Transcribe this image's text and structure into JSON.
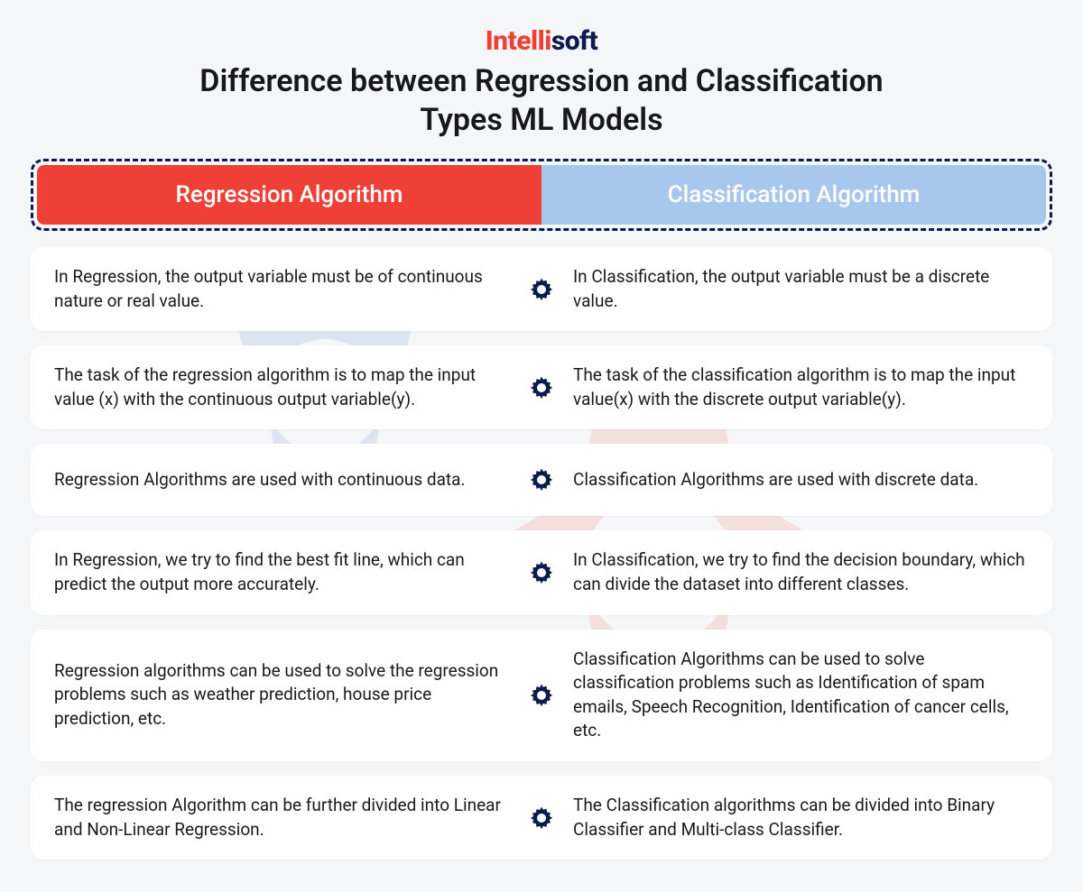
{
  "logo": {
    "part1": "Intelli",
    "part2": "soft"
  },
  "title_line1": "Difference between Regression and Classification",
  "title_line2": "Types ML Models",
  "header": {
    "left": "Regression Algorithm",
    "right": "Classification Algorithm"
  },
  "rows": [
    {
      "left": "In Regression, the output variable must be of continuous nature or real value.",
      "right": "In Classification, the output variable must be a discrete value."
    },
    {
      "left": "The task of the regression algorithm is to map the input value (x) with the continuous output variable(y).",
      "right": "The task of the classification algorithm is to map the input value(x) with the discrete output variable(y)."
    },
    {
      "left": "Regression Algorithms are used with continuous data.",
      "right": "Classification Algorithms are used with discrete data."
    },
    {
      "left": "In Regression, we try to find the best fit line, which can predict the output more accurately.",
      "right": "In Classification, we try to find the decision boundary, which can divide the dataset into different classes."
    },
    {
      "left": "Regression algorithms can be used to solve the regression problems such as weather prediction, house price prediction, etc.",
      "right": "Classification Algorithms can be used to solve classification problems such as Identification of spam emails, Speech Recognition, Identification of cancer cells, etc."
    },
    {
      "left": "The regression Algorithm can be further divided into Linear and Non-Linear Regression.",
      "right": "The Classification algorithms can be divided into Binary Classifier and Multi-class Classifier."
    }
  ],
  "colors": {
    "accent_red": "#ee4036",
    "accent_blue": "#a7c7ed",
    "navy": "#0d1b4c"
  }
}
